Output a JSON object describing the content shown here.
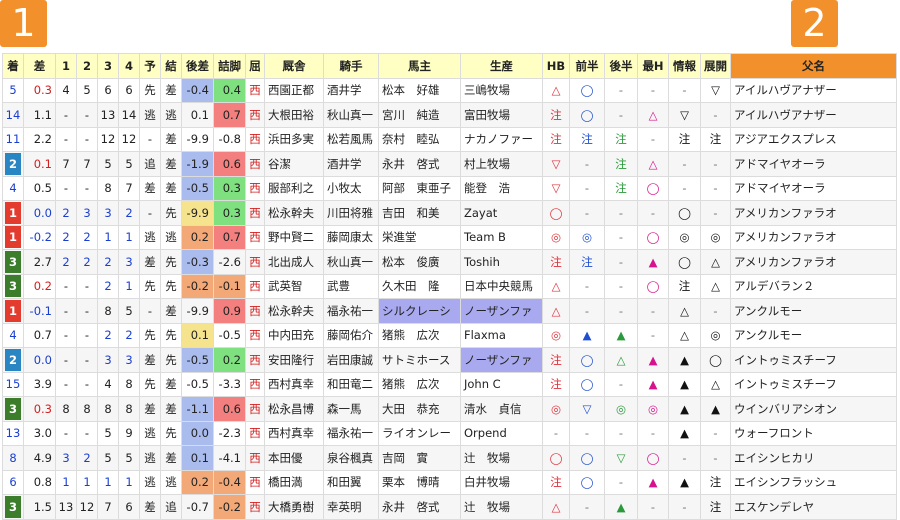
{
  "badges": {
    "left": "1",
    "right": "2"
  },
  "colors": {
    "badge": "#f2912b",
    "header_bg": "#ffffc4",
    "rank1": "#e43b2f",
    "rank2": "#2a86c2",
    "rank3": "#3c7d2c"
  },
  "headers": [
    "着",
    "差",
    "1",
    "2",
    "3",
    "4",
    "予",
    "結",
    "後差",
    "詰脚",
    "屈",
    "厩舎",
    "騎手",
    "馬主",
    "生産",
    "HB",
    "前半",
    "後半",
    "最H",
    "情報",
    "展開",
    "父名"
  ],
  "rows": [
    {
      "rank": "5",
      "rk": 0,
      "diff": "0.3",
      "c1": "4",
      "c2": "5",
      "c3": "6",
      "c4": "6",
      "pred": "先",
      "res": "差",
      "kosa": "-0.4",
      "kosa_bg": "#aabbee",
      "tsume": "0.4",
      "tsume_bg": "#7fe07f",
      "kutsu": "西",
      "trainer": "西園正都",
      "jockey": "酒井学",
      "owner": "松本　好雄",
      "breeder": "三嶋牧場",
      "hb": "△",
      "hb_c": "mk-red",
      "zen": "◯",
      "zen_c": "mk-blue",
      "kou": "-",
      "kou_c": "mk-gray",
      "saih": "-",
      "saih_c": "mk-gray",
      "info": "-",
      "info_c": "mk-gray",
      "tenkai": "▽",
      "tenkai_c": "mk-black",
      "sire": "アイルハヴアナザー"
    },
    {
      "rank": "14",
      "rk": 0,
      "diff": "1.1",
      "c1": "-",
      "c2": "-",
      "c3": "13",
      "c4": "14",
      "pred": "逃",
      "res": "逃",
      "kosa": "0.1",
      "kosa_bg": "",
      "tsume": "0.7",
      "tsume_bg": "#f37f7f",
      "kutsu": "西",
      "trainer": "大根田裕",
      "jockey": "秋山真一",
      "owner": "宮川　純造",
      "breeder": "富田牧場",
      "hb": "注",
      "hb_c": "mk-red",
      "zen": "◯",
      "zen_c": "mk-blue",
      "kou": "-",
      "kou_c": "mk-gray",
      "saih": "△",
      "saih_c": "mk-pink",
      "info": "▽",
      "info_c": "mk-black",
      "tenkai": "-",
      "tenkai_c": "mk-gray",
      "sire": "アイルハヴアナザー"
    },
    {
      "rank": "11",
      "rk": 0,
      "diff": "2.2",
      "c1": "-",
      "c2": "-",
      "c3": "12",
      "c4": "12",
      "pred": "-",
      "res": "差",
      "kosa": "-9.9",
      "kosa_bg": "",
      "tsume": "-0.8",
      "tsume_bg": "",
      "kutsu": "西",
      "trainer": "浜田多実",
      "jockey": "松若風馬",
      "owner": "奈村　睦弘",
      "breeder": "ナカノファー",
      "hb": "注",
      "hb_c": "mk-red",
      "zen": "注",
      "zen_c": "mk-blue",
      "kou": "注",
      "kou_c": "mk-green",
      "saih": "-",
      "saih_c": "mk-gray",
      "info": "注",
      "info_c": "mk-black",
      "tenkai": "注",
      "tenkai_c": "mk-black",
      "sire": "アジアエクスプレス"
    },
    {
      "rank": "2",
      "rk": 2,
      "diff": "0.1",
      "c1": "7",
      "c2": "7",
      "c3": "5",
      "c4": "5",
      "pred": "追",
      "res": "差",
      "kosa": "-1.9",
      "kosa_bg": "#aabbee",
      "tsume": "0.6",
      "tsume_bg": "#f37f7f",
      "kutsu": "西",
      "trainer": "谷潔",
      "jockey": "酒井学",
      "owner": "永井　啓式",
      "breeder": "村上牧場",
      "hb": "▽",
      "hb_c": "mk-red",
      "zen": "-",
      "zen_c": "mk-gray",
      "kou": "注",
      "kou_c": "mk-green",
      "saih": "△",
      "saih_c": "mk-pink",
      "info": "-",
      "info_c": "mk-gray",
      "tenkai": "-",
      "tenkai_c": "mk-gray",
      "sire": "アドマイヤオーラ"
    },
    {
      "rank": "4",
      "rk": 0,
      "diff": "0.5",
      "c1": "-",
      "c2": "-",
      "c3": "8",
      "c4": "7",
      "pred": "差",
      "res": "差",
      "kosa": "-0.5",
      "kosa_bg": "#aabbee",
      "tsume": "0.3",
      "tsume_bg": "#7fe07f",
      "kutsu": "西",
      "trainer": "服部利之",
      "jockey": "小牧太",
      "owner": "阿部　東亜子",
      "breeder": "能登　浩",
      "hb": "▽",
      "hb_c": "mk-red",
      "zen": "-",
      "zen_c": "mk-gray",
      "kou": "注",
      "kou_c": "mk-green",
      "saih": "◯",
      "saih_c": "mk-pink",
      "info": "-",
      "info_c": "mk-gray",
      "tenkai": "-",
      "tenkai_c": "mk-gray",
      "sire": "アドマイヤオーラ"
    },
    {
      "rank": "1",
      "rk": 1,
      "diff": "0.0",
      "c1": "2",
      "c2": "3",
      "c3": "3",
      "c4": "2",
      "pred": "-",
      "res": "先",
      "kosa": "-9.9",
      "kosa_bg": "#f5e38e",
      "tsume": "0.3",
      "tsume_bg": "#7fe07f",
      "kutsu": "西",
      "trainer": "松永幹夫",
      "jockey": "川田将雅",
      "owner": "吉田　和美",
      "breeder": "Zayat",
      "hb": "◯",
      "hb_c": "mk-red",
      "zen": "-",
      "zen_c": "mk-gray",
      "kou": "-",
      "kou_c": "mk-gray",
      "saih": "-",
      "saih_c": "mk-gray",
      "info": "◯",
      "info_c": "mk-black",
      "tenkai": "-",
      "tenkai_c": "mk-gray",
      "sire": "アメリカンファラオ"
    },
    {
      "rank": "1",
      "rk": 1,
      "diff": "-0.2",
      "c1": "2",
      "c2": "2",
      "c3": "1",
      "c4": "1",
      "pred": "逃",
      "res": "逃",
      "kosa": "0.2",
      "kosa_bg": "#f3a877",
      "tsume": "0.7",
      "tsume_bg": "#f37f7f",
      "kutsu": "西",
      "trainer": "野中賢二",
      "jockey": "藤岡康太",
      "owner": "栄進堂",
      "breeder": "Team B",
      "hb": "◎",
      "hb_c": "mk-red",
      "zen": "◎",
      "zen_c": "mk-blue",
      "kou": "-",
      "kou_c": "mk-gray",
      "saih": "◯",
      "saih_c": "mk-pink",
      "info": "◎",
      "info_c": "mk-black",
      "tenkai": "◎",
      "tenkai_c": "mk-black",
      "sire": "アメリカンファラオ"
    },
    {
      "rank": "3",
      "rk": 3,
      "diff": "2.7",
      "c1": "2",
      "c2": "2",
      "c3": "2",
      "c4": "3",
      "pred": "差",
      "res": "先",
      "kosa": "-0.3",
      "kosa_bg": "#aabbee",
      "tsume": "-2.6",
      "tsume_bg": "",
      "kutsu": "西",
      "trainer": "北出成人",
      "jockey": "秋山真一",
      "owner": "松本　俊廣",
      "breeder": "Toshih",
      "hb": "注",
      "hb_c": "mk-red",
      "zen": "注",
      "zen_c": "mk-blue",
      "kou": "-",
      "kou_c": "mk-gray",
      "saih": "▲",
      "saih_c": "mk-pink",
      "info": "◯",
      "info_c": "mk-black",
      "tenkai": "△",
      "tenkai_c": "mk-black",
      "sire": "アメリカンファラオ"
    },
    {
      "rank": "3",
      "rk": 3,
      "diff": "0.2",
      "c1": "-",
      "c2": "-",
      "c3": "2",
      "c4": "1",
      "pred": "先",
      "res": "先",
      "kosa": "-0.2",
      "kosa_bg": "#f3a877",
      "tsume": "-0.1",
      "tsume_bg": "#f3a877",
      "kutsu": "西",
      "trainer": "武英智",
      "jockey": "武豊",
      "owner": "久木田　隆",
      "breeder": "日本中央競馬",
      "hb": "△",
      "hb_c": "mk-red",
      "zen": "-",
      "zen_c": "mk-gray",
      "kou": "-",
      "kou_c": "mk-gray",
      "saih": "◯",
      "saih_c": "mk-pink",
      "info": "注",
      "info_c": "mk-black",
      "tenkai": "△",
      "tenkai_c": "mk-black",
      "sire": "アルデバラン２"
    },
    {
      "rank": "1",
      "rk": 1,
      "diff": "-0.1",
      "c1": "-",
      "c2": "-",
      "c3": "8",
      "c4": "5",
      "pred": "-",
      "res": "差",
      "kosa": "-9.9",
      "kosa_bg": "",
      "tsume": "0.9",
      "tsume_bg": "#f37f7f",
      "kutsu": "西",
      "trainer": "松永幹夫",
      "jockey": "福永祐一",
      "owner": "シルクレーシ",
      "owner_hl": true,
      "breeder": "ノーザンファ",
      "breeder_hl": true,
      "hb": "△",
      "hb_c": "mk-red",
      "zen": "-",
      "zen_c": "mk-gray",
      "kou": "-",
      "kou_c": "mk-gray",
      "saih": "-",
      "saih_c": "mk-gray",
      "info": "△",
      "info_c": "mk-black",
      "tenkai": "-",
      "tenkai_c": "mk-gray",
      "sire": "アンクルモー"
    },
    {
      "rank": "4",
      "rk": 0,
      "diff": "0.7",
      "c1": "-",
      "c2": "-",
      "c3": "2",
      "c4": "2",
      "pred": "先",
      "res": "先",
      "kosa": "0.1",
      "kosa_bg": "#f5e38e",
      "tsume": "-0.5",
      "tsume_bg": "",
      "kutsu": "西",
      "trainer": "中内田充",
      "jockey": "藤岡佑介",
      "owner": "猪熊　広次",
      "breeder": "Flaxma",
      "hb": "◎",
      "hb_c": "mk-red",
      "zen": "▲",
      "zen_c": "mk-blue",
      "kou": "▲",
      "kou_c": "mk-green",
      "saih": "-",
      "saih_c": "mk-gray",
      "info": "△",
      "info_c": "mk-black",
      "tenkai": "◎",
      "tenkai_c": "mk-black",
      "sire": "アンクルモー"
    },
    {
      "rank": "2",
      "rk": 2,
      "diff": "0.0",
      "c1": "-",
      "c2": "-",
      "c3": "3",
      "c4": "3",
      "pred": "差",
      "res": "先",
      "kosa": "-0.5",
      "kosa_bg": "#aabbee",
      "tsume": "0.2",
      "tsume_bg": "#7fe07f",
      "kutsu": "西",
      "trainer": "安田隆行",
      "jockey": "岩田康誠",
      "owner": "サトミホース",
      "breeder": "ノーザンファ",
      "breeder_hl": true,
      "hb": "注",
      "hb_c": "mk-red",
      "zen": "◯",
      "zen_c": "mk-blue",
      "kou": "△",
      "kou_c": "mk-green",
      "saih": "▲",
      "saih_c": "mk-pink",
      "info": "▲",
      "info_c": "mk-black",
      "tenkai": "◯",
      "tenkai_c": "mk-black",
      "sire": "イントゥミスチーフ"
    },
    {
      "rank": "15",
      "rk": 0,
      "diff": "3.9",
      "c1": "-",
      "c2": "-",
      "c3": "4",
      "c4": "8",
      "pred": "先",
      "res": "差",
      "kosa": "-0.5",
      "kosa_bg": "",
      "tsume": "-3.3",
      "tsume_bg": "",
      "kutsu": "西",
      "trainer": "西村真幸",
      "jockey": "和田竜二",
      "owner": "猪熊　広次",
      "breeder": "John C",
      "hb": "注",
      "hb_c": "mk-red",
      "zen": "◯",
      "zen_c": "mk-blue",
      "kou": "-",
      "kou_c": "mk-gray",
      "saih": "▲",
      "saih_c": "mk-pink",
      "info": "▲",
      "info_c": "mk-black",
      "tenkai": "△",
      "tenkai_c": "mk-black",
      "sire": "イントゥミスチーフ"
    },
    {
      "rank": "3",
      "rk": 3,
      "diff": "0.3",
      "c1": "8",
      "c2": "8",
      "c3": "8",
      "c4": "8",
      "pred": "差",
      "res": "差",
      "kosa": "-1.1",
      "kosa_bg": "#aabbee",
      "tsume": "0.6",
      "tsume_bg": "#f37f7f",
      "kutsu": "西",
      "trainer": "松永昌博",
      "jockey": "森一馬",
      "owner": "大田　恭充",
      "breeder": "清水　貞信",
      "hb": "◎",
      "hb_c": "mk-red",
      "zen": "▽",
      "zen_c": "mk-blue",
      "kou": "◎",
      "kou_c": "mk-green",
      "saih": "◎",
      "saih_c": "mk-pink",
      "info": "▲",
      "info_c": "mk-black",
      "tenkai": "▲",
      "tenkai_c": "mk-black",
      "sire": "ウインバリアシオン"
    },
    {
      "rank": "13",
      "rk": 0,
      "diff": "3.0",
      "c1": "-",
      "c2": "-",
      "c3": "5",
      "c4": "9",
      "pred": "逃",
      "res": "先",
      "kosa": "0.0",
      "kosa_bg": "#aabbee",
      "tsume": "-2.3",
      "tsume_bg": "",
      "kutsu": "西",
      "trainer": "西村真幸",
      "jockey": "福永祐一",
      "owner": "ライオンレー",
      "breeder": "Orpend",
      "hb": "-",
      "hb_c": "mk-gray",
      "zen": "-",
      "zen_c": "mk-gray",
      "kou": "-",
      "kou_c": "mk-gray",
      "saih": "-",
      "saih_c": "mk-gray",
      "info": "▲",
      "info_c": "mk-black",
      "tenkai": "-",
      "tenkai_c": "mk-gray",
      "sire": "ウォーフロント"
    },
    {
      "rank": "8",
      "rk": 0,
      "diff": "4.9",
      "c1": "3",
      "c2": "2",
      "c3": "5",
      "c4": "5",
      "pred": "逃",
      "res": "差",
      "kosa": "0.1",
      "kosa_bg": "#aabbee",
      "tsume": "-4.1",
      "tsume_bg": "",
      "kutsu": "西",
      "trainer": "本田優",
      "jockey": "泉谷楓真",
      "owner": "吉岡　實",
      "breeder": "辻　牧場",
      "hb": "◯",
      "hb_c": "mk-red",
      "zen": "◯",
      "zen_c": "mk-blue",
      "kou": "▽",
      "kou_c": "mk-green",
      "saih": "◯",
      "saih_c": "mk-pink",
      "info": "-",
      "info_c": "mk-gray",
      "tenkai": "-",
      "tenkai_c": "mk-gray",
      "sire": "エイシンヒカリ"
    },
    {
      "rank": "6",
      "rk": 0,
      "diff": "0.8",
      "c1": "1",
      "c2": "1",
      "c3": "1",
      "c4": "1",
      "pred": "逃",
      "res": "逃",
      "kosa": "0.2",
      "kosa_bg": "#f3a877",
      "tsume": "-0.4",
      "tsume_bg": "#f3a877",
      "kutsu": "西",
      "trainer": "橋田満",
      "jockey": "和田翼",
      "owner": "栗本　博晴",
      "breeder": "白井牧場",
      "hb": "注",
      "hb_c": "mk-red",
      "zen": "◯",
      "zen_c": "mk-blue",
      "kou": "-",
      "kou_c": "mk-gray",
      "saih": "▲",
      "saih_c": "mk-pink",
      "info": "▲",
      "info_c": "mk-black",
      "tenkai": "注",
      "tenkai_c": "mk-black",
      "sire": "エイシンフラッシュ"
    },
    {
      "rank": "3",
      "rk": 3,
      "diff": "1.5",
      "c1": "13",
      "c2": "12",
      "c3": "7",
      "c4": "6",
      "pred": "差",
      "res": "追",
      "kosa": "-0.7",
      "kosa_bg": "",
      "tsume": "-0.2",
      "tsume_bg": "#f3a877",
      "kutsu": "西",
      "trainer": "大橋勇樹",
      "jockey": "幸英明",
      "owner": "永井　啓式",
      "breeder": "辻　牧場",
      "hb": "△",
      "hb_c": "mk-red",
      "zen": "-",
      "zen_c": "mk-gray",
      "kou": "▲",
      "kou_c": "mk-green",
      "saih": "-",
      "saih_c": "mk-gray",
      "info": "-",
      "info_c": "mk-gray",
      "tenkai": "注",
      "tenkai_c": "mk-black",
      "sire": "エスケンデレヤ"
    }
  ]
}
